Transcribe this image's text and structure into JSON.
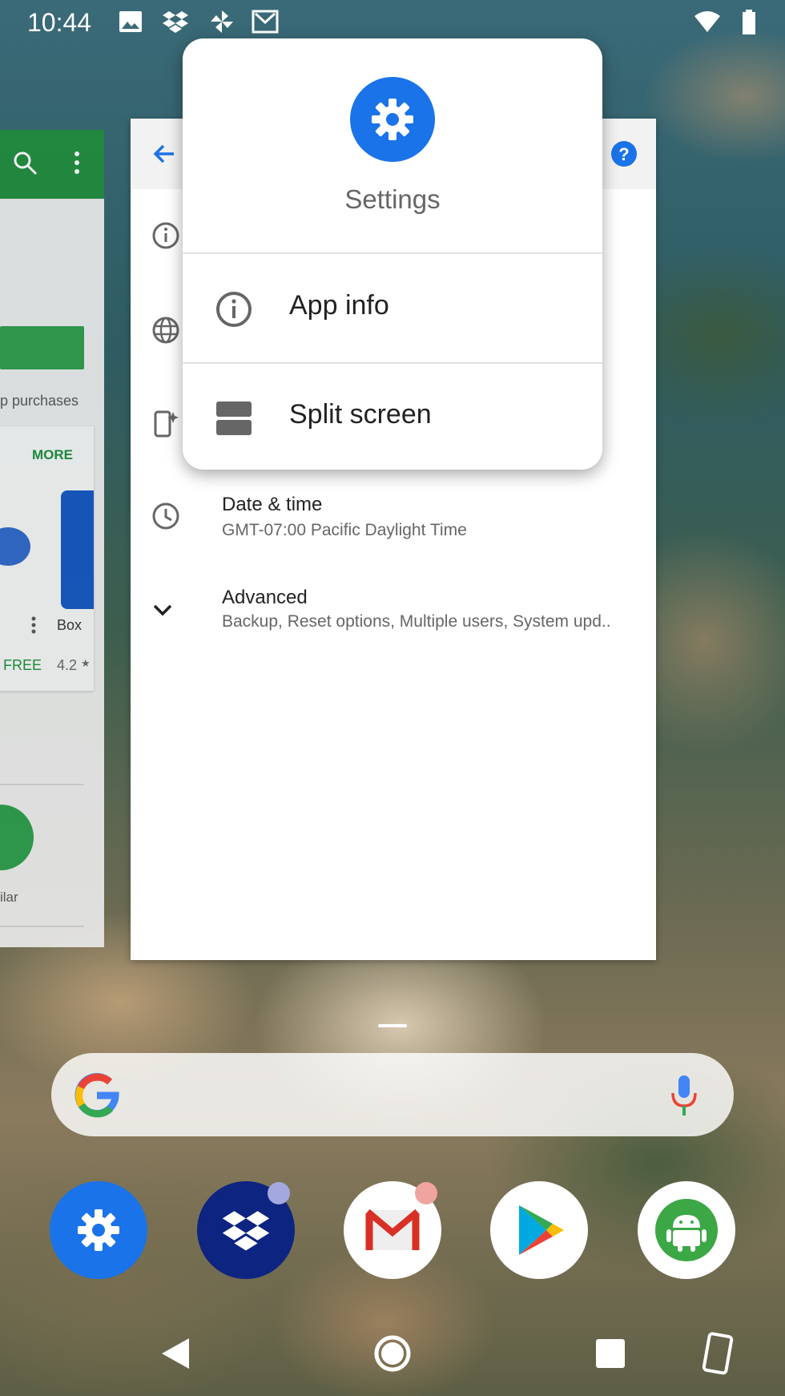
{
  "status_bar": {
    "time": "10:44",
    "icons": [
      "image-icon",
      "dropbox-icon",
      "pinwheel-icon",
      "gmail-icon",
      "wifi-icon",
      "battery-icon"
    ]
  },
  "background_card": {
    "app": "Play Store",
    "text_purchases": "p purchases",
    "more": "MORE",
    "app_name": "Box",
    "price": "FREE",
    "rating": "4.2",
    "rating_star": "★",
    "similar": "ilar"
  },
  "settings_card": {
    "rows": [
      {
        "title": "Date & time",
        "subtitle": "GMT-07:00 Pacific Daylight Time"
      },
      {
        "title": "Advanced",
        "subtitle": "Backup, Reset options, Multiple users, System upd.."
      }
    ]
  },
  "popup": {
    "app_title": "Settings",
    "items": [
      {
        "label": "App info",
        "icon": "info-icon"
      },
      {
        "label": "Split screen",
        "icon": "split-screen-icon"
      }
    ]
  },
  "dock": {
    "apps": [
      "Settings",
      "Dropbox",
      "Gmail",
      "Play Store",
      "Android"
    ]
  },
  "colors": {
    "accent_blue": "#1a73e8",
    "play_green": "#218a3b",
    "dropbox_navy": "#0d2481"
  }
}
